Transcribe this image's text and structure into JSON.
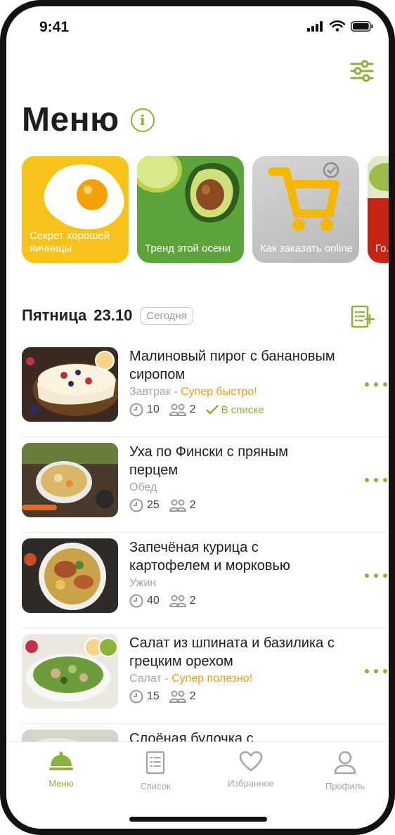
{
  "status": {
    "time": "9:41"
  },
  "header": {
    "title": "Меню"
  },
  "stories": [
    {
      "label": "Секрет хорошей яичницы"
    },
    {
      "label": "Тренд этой осени"
    },
    {
      "label": "Как заказать online"
    },
    {
      "label": "Го... со..."
    }
  ],
  "day": {
    "name": "Пятница",
    "date": "23.10",
    "today": "Сегодня"
  },
  "recipes": [
    {
      "name": "Малиновый пирог с банановым сиропом",
      "category": "Завтрак",
      "separator": " - ",
      "note": "Супер быстро!",
      "time": "10",
      "servings": "2",
      "in_list": "В списке"
    },
    {
      "name": "Уха по Фински с пряным перцем",
      "category": "Обед",
      "time": "25",
      "servings": "2"
    },
    {
      "name": "Запечёная курица с картофелем и морковью",
      "category": "Ужин",
      "time": "40",
      "servings": "2"
    },
    {
      "name": "Салат из шпината и базилика с грецким орехом",
      "category": "Салат",
      "separator": " - ",
      "note": "Супер полезно!",
      "time": "15",
      "servings": "2"
    },
    {
      "name": "Слоёная булочка с"
    }
  ],
  "tabs": [
    {
      "label": "Меню",
      "icon": "cloche-icon",
      "active": true
    },
    {
      "label": "Список",
      "icon": "list-icon"
    },
    {
      "label": "Избранное",
      "icon": "heart-icon"
    },
    {
      "label": "Профиль",
      "icon": "user-icon"
    }
  ],
  "colors": {
    "accent": "#8ab33b",
    "note": "#f39c12",
    "muted": "#a3a3a3"
  }
}
